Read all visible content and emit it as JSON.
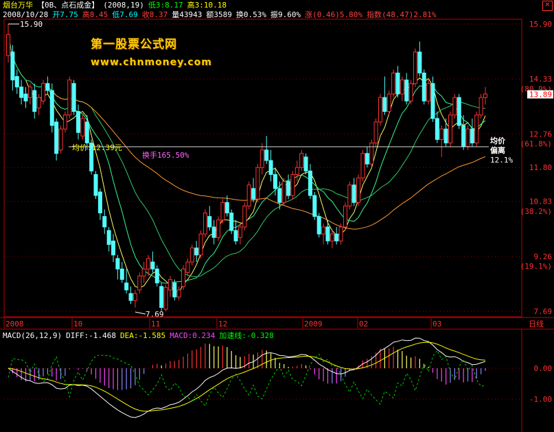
{
  "header": {
    "stock_name": "烟台万华",
    "sector": "【0B、点石成金】",
    "params": "(2008,19)",
    "low3": "低3:8.17",
    "high3": "高3:10.18",
    "date": "2008/10/28",
    "open": "开7.75",
    "high": "高8.45",
    "low": "低7.69",
    "close": "收8.37",
    "volume": "量43943",
    "amount": "额3589",
    "turnover": "换0.53%",
    "amplitude": "振9.60%",
    "change": "涨(0.46)5.80%",
    "index": "指数(48.47)2.81%",
    "close_icon": "close-x-icon"
  },
  "watermark": {
    "line1": "第一股票公式网",
    "line2": "www.chnmoney.com"
  },
  "annotations": {
    "avg_price": "均价:12.39元",
    "turnover_total": "换手165.50%",
    "avg_dev_1": "均价",
    "avg_dev_2": "偏离",
    "avg_dev_3": "12.1%",
    "max_label": "15.90",
    "min_label": "7.69"
  },
  "macd_header": {
    "macd": "MACD(26,12,9)",
    "diff": "DIFF:-1.468",
    "dea": "DEA:-1.585",
    "macd_val": "MACD:0.234",
    "accel": "加速线:-0.328"
  },
  "colors": {
    "up": "#ff3232",
    "down": "#54fcfc",
    "ma_orange": "#ff9933",
    "ma_green": "#33cc66",
    "ma_yellow": "#ffff66",
    "grid": "#a00000",
    "axis": "#c00000"
  },
  "chart_data": {
    "type": "candlestick",
    "price_ticks": [
      "15.90",
      "14.33",
      "(80.9%)",
      "12.76",
      "(61.8%)",
      "11.80",
      "10.83",
      "(38.2%)",
      "9.26",
      "(19.1%)",
      "7.69"
    ],
    "last_price": "13.89",
    "time_labels": [
      "2008",
      "10",
      "11",
      "12",
      "2009",
      "02",
      "03",
      "日线"
    ],
    "macd_ticks": [
      "0.00",
      "-1.00"
    ],
    "ylim": [
      7.69,
      15.9
    ],
    "candles": [
      [
        15.0,
        15.9,
        14.8,
        15.6
      ],
      [
        15.1,
        15.3,
        14.0,
        14.3
      ],
      [
        14.4,
        14.6,
        13.9,
        14.1
      ],
      [
        14.1,
        14.3,
        13.6,
        13.8
      ],
      [
        13.9,
        14.1,
        13.5,
        13.7
      ],
      [
        13.8,
        14.2,
        13.6,
        14.1
      ],
      [
        14.0,
        14.2,
        13.2,
        13.4
      ],
      [
        13.5,
        13.9,
        13.3,
        13.8
      ],
      [
        13.7,
        14.3,
        13.6,
        14.2
      ],
      [
        14.2,
        14.4,
        13.9,
        14.0
      ],
      [
        14.0,
        14.2,
        12.8,
        13.0
      ],
      [
        13.1,
        13.2,
        12.0,
        12.2
      ],
      [
        12.3,
        13.0,
        12.2,
        12.9
      ],
      [
        12.9,
        13.4,
        12.8,
        13.3
      ],
      [
        13.3,
        14.4,
        13.2,
        14.3
      ],
      [
        14.2,
        14.3,
        13.3,
        13.4
      ],
      [
        13.4,
        13.6,
        12.6,
        12.8
      ],
      [
        12.7,
        13.3,
        12.6,
        13.2
      ],
      [
        13.1,
        13.3,
        12.3,
        12.5
      ],
      [
        12.5,
        12.6,
        11.6,
        11.7
      ],
      [
        11.6,
        11.7,
        10.9,
        11.0
      ],
      [
        11.1,
        11.2,
        10.3,
        10.5
      ],
      [
        10.4,
        10.6,
        9.9,
        10.1
      ],
      [
        10.0,
        10.1,
        9.4,
        9.6
      ],
      [
        9.7,
        9.9,
        9.1,
        9.3
      ],
      [
        9.2,
        9.3,
        8.6,
        8.9
      ],
      [
        8.9,
        9.1,
        8.5,
        8.6
      ],
      [
        8.5,
        8.9,
        8.2,
        8.3
      ],
      [
        8.2,
        8.4,
        7.9,
        8.0
      ],
      [
        8.0,
        8.3,
        7.8,
        8.2
      ],
      [
        8.3,
        8.8,
        8.2,
        8.7
      ],
      [
        8.7,
        9.1,
        8.5,
        8.9
      ],
      [
        8.9,
        9.3,
        8.7,
        9.2
      ],
      [
        9.1,
        9.4,
        8.8,
        8.9
      ],
      [
        8.9,
        9.0,
        8.4,
        8.5
      ],
      [
        8.4,
        8.5,
        7.7,
        7.8
      ],
      [
        7.75,
        8.45,
        7.69,
        8.37
      ],
      [
        8.3,
        8.7,
        8.1,
        8.6
      ],
      [
        8.5,
        8.6,
        8.0,
        8.1
      ],
      [
        8.1,
        8.4,
        8.0,
        8.3
      ],
      [
        8.4,
        9.0,
        8.3,
        8.9
      ],
      [
        8.8,
        9.2,
        8.7,
        9.1
      ],
      [
        9.1,
        9.6,
        9.0,
        9.5
      ],
      [
        9.5,
        9.7,
        9.1,
        9.3
      ],
      [
        9.3,
        10.0,
        9.2,
        9.9
      ],
      [
        9.9,
        10.6,
        9.8,
        10.5
      ],
      [
        10.4,
        10.7,
        10.0,
        10.1
      ],
      [
        10.1,
        10.3,
        9.6,
        9.8
      ],
      [
        9.8,
        10.4,
        9.7,
        10.3
      ],
      [
        10.3,
        10.9,
        10.2,
        10.8
      ],
      [
        10.8,
        11.0,
        10.4,
        10.5
      ],
      [
        10.5,
        10.6,
        9.9,
        10.0
      ],
      [
        10.0,
        10.3,
        9.6,
        9.7
      ],
      [
        9.8,
        10.2,
        9.6,
        10.1
      ],
      [
        10.1,
        10.8,
        10.0,
        10.7
      ],
      [
        10.7,
        11.4,
        10.6,
        11.3
      ],
      [
        11.2,
        11.5,
        10.8,
        10.9
      ],
      [
        10.9,
        11.9,
        10.8,
        11.8
      ],
      [
        11.8,
        12.5,
        11.6,
        12.3
      ],
      [
        12.3,
        12.7,
        11.9,
        12.0
      ],
      [
        12.0,
        12.3,
        11.4,
        11.6
      ],
      [
        11.6,
        11.8,
        11.0,
        11.2
      ],
      [
        11.2,
        11.4,
        10.6,
        10.8
      ],
      [
        10.8,
        11.5,
        10.7,
        11.4
      ],
      [
        11.4,
        11.6,
        10.9,
        11.0
      ],
      [
        11.0,
        11.7,
        10.9,
        11.6
      ],
      [
        11.6,
        12.0,
        11.4,
        11.8
      ],
      [
        11.8,
        12.3,
        11.7,
        12.2
      ],
      [
        12.1,
        12.2,
        11.6,
        11.7
      ],
      [
        11.7,
        11.9,
        10.9,
        11.0
      ],
      [
        11.0,
        11.1,
        10.3,
        10.4
      ],
      [
        10.4,
        10.5,
        9.8,
        9.9
      ],
      [
        9.9,
        10.2,
        9.6,
        10.1
      ],
      [
        10.1,
        10.3,
        9.6,
        9.7
      ],
      [
        9.7,
        10.0,
        9.5,
        9.9
      ],
      [
        9.9,
        10.1,
        9.6,
        9.7
      ],
      [
        9.7,
        10.2,
        9.6,
        10.1
      ],
      [
        10.1,
        10.8,
        10.0,
        10.7
      ],
      [
        10.7,
        11.4,
        10.6,
        11.3
      ],
      [
        11.3,
        11.5,
        10.7,
        10.8
      ],
      [
        10.8,
        11.6,
        10.7,
        11.5
      ],
      [
        11.5,
        12.3,
        11.4,
        12.2
      ],
      [
        12.2,
        12.4,
        11.8,
        11.9
      ],
      [
        11.9,
        12.6,
        11.8,
        12.5
      ],
      [
        12.5,
        13.2,
        12.4,
        13.1
      ],
      [
        13.1,
        13.9,
        13.0,
        13.8
      ],
      [
        13.8,
        14.4,
        13.3,
        13.4
      ],
      [
        13.4,
        14.0,
        13.3,
        13.9
      ],
      [
        13.9,
        14.6,
        13.8,
        14.5
      ],
      [
        14.5,
        14.7,
        13.8,
        13.9
      ],
      [
        13.9,
        14.4,
        13.7,
        14.3
      ],
      [
        14.3,
        14.5,
        13.6,
        13.7
      ],
      [
        13.7,
        14.3,
        13.6,
        14.2
      ],
      [
        14.2,
        15.2,
        14.1,
        15.1
      ],
      [
        15.1,
        15.4,
        14.4,
        14.5
      ],
      [
        14.5,
        14.6,
        13.6,
        13.7
      ],
      [
        13.7,
        14.3,
        13.6,
        14.2
      ],
      [
        14.2,
        14.4,
        13.1,
        13.2
      ],
      [
        13.2,
        13.4,
        12.5,
        12.6
      ],
      [
        12.6,
        13.0,
        12.1,
        12.9
      ],
      [
        12.9,
        13.2,
        12.4,
        12.5
      ],
      [
        12.5,
        13.4,
        12.4,
        13.3
      ],
      [
        13.3,
        13.9,
        13.2,
        13.8
      ],
      [
        13.8,
        13.9,
        12.9,
        13.0
      ],
      [
        13.0,
        13.3,
        12.3,
        12.4
      ],
      [
        12.4,
        13.0,
        12.3,
        12.9
      ],
      [
        12.9,
        13.2,
        12.4,
        12.5
      ],
      [
        12.5,
        13.4,
        12.4,
        13.3
      ],
      [
        13.3,
        13.9,
        13.2,
        13.8
      ],
      [
        13.8,
        14.1,
        13.6,
        13.9
      ]
    ]
  }
}
